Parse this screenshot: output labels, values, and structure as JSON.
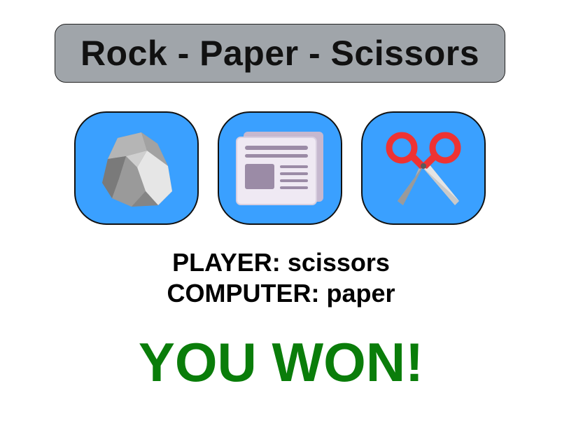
{
  "title": "Rock - Paper - Scissors",
  "choices": [
    {
      "id": "rock",
      "icon": "rock-icon"
    },
    {
      "id": "paper",
      "icon": "newspaper-icon"
    },
    {
      "id": "scissors",
      "icon": "scissors-icon"
    }
  ],
  "result": {
    "player_label": "PLAYER:",
    "player_choice": "scissors",
    "computer_label": "COMPUTER:",
    "computer_choice": "paper",
    "outcome": "YOU WON!"
  },
  "colors": {
    "title_bg": "#a0a5aa",
    "button_bg": "#3aa0ff",
    "outcome": "#0a7d0a"
  }
}
